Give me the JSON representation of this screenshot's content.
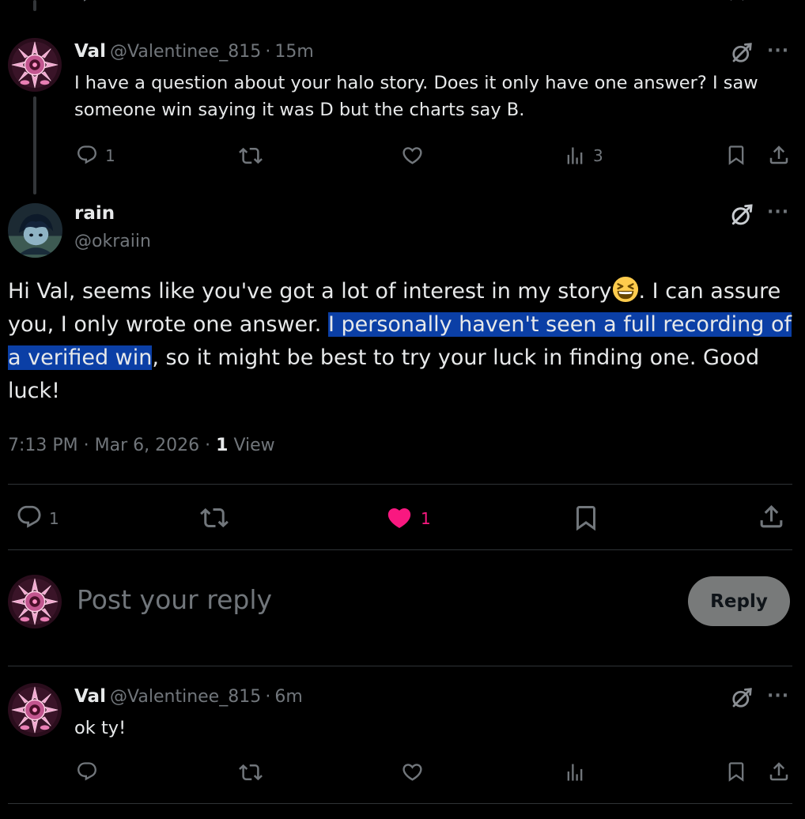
{
  "colors": {
    "background": "#000000",
    "text": "#e7e9ea",
    "muted": "#71767b",
    "like": "#f91880",
    "highlight": "#0b3fa6",
    "reply_button": "#787a7a"
  },
  "tweet1": {
    "name": "Val",
    "handle": "@Valentinee_815",
    "sep": "·",
    "time": "15m",
    "text": "I have a question about your halo story. Does it only have one answer? I saw someone win saying it was D but the charts say B.",
    "reply_count": "1",
    "views_count": "3",
    "more": "···"
  },
  "main": {
    "name": "rain",
    "handle": "@okraiin",
    "text_before_emoji": "Hi Val, seems like you've got a lot of interest in my story",
    "emoji": "grinning-squinting-face",
    "text_after_emoji": ". I can assure you, I only wrote one answer. ",
    "text_highlighted": "I personally haven't seen a full recording of a verified win",
    "text_end": ", so it might be best to try your luck in finding one. Good luck!",
    "time": "7:13 PM",
    "date": "Mar 6, 2026",
    "sep": "·",
    "views_count": "1",
    "views_label": "View",
    "reply_count": "1",
    "like_count": "1",
    "more": "···"
  },
  "composer": {
    "placeholder": "Post your reply",
    "reply_label": "Reply"
  },
  "tweet2": {
    "name": "Val",
    "handle": "@Valentinee_815",
    "sep": "·",
    "time": "6m",
    "text": "ok ty!",
    "more": "···"
  }
}
